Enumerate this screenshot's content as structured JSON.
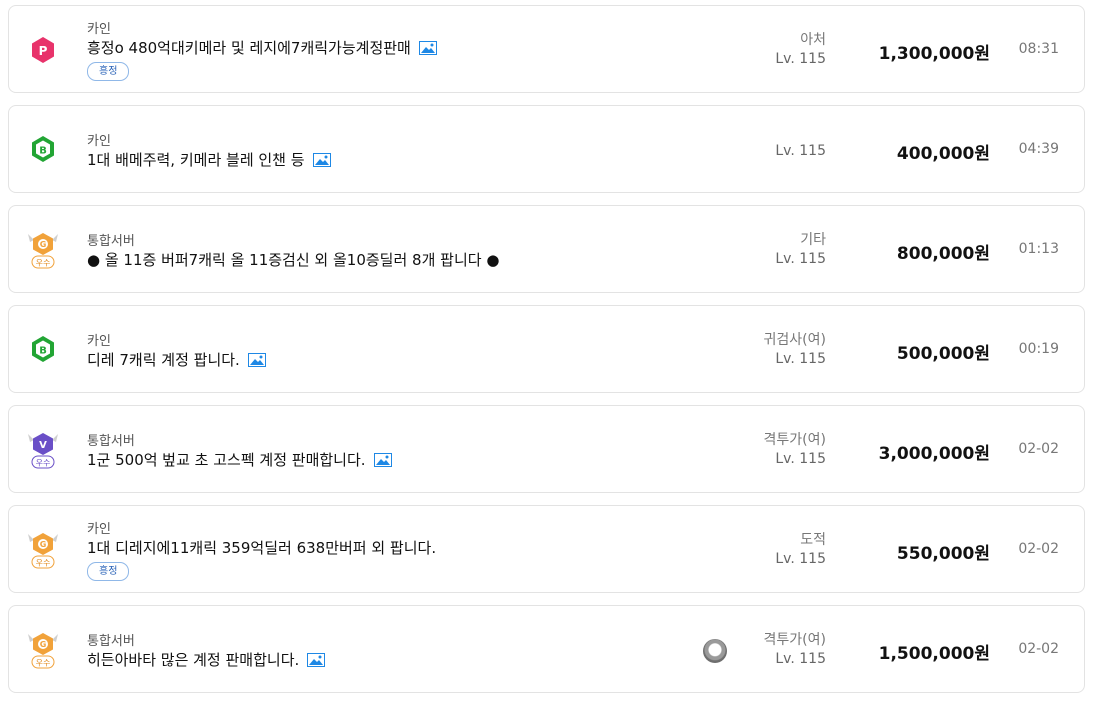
{
  "colors": {
    "p_badge": "#e8336b",
    "b_badge": "#22a534",
    "v_badge": "#6a4fc7",
    "gold_badge": "#f1a23a",
    "tag_border": "#90b8e8",
    "tag_text": "#2b64b8",
    "image_icon": "#1e88e5"
  },
  "listings": [
    {
      "badge": "p-badge-icon",
      "server": "카인",
      "title": "흥정o 480억대키메라 및 레지에7캐릭가능계정판매",
      "has_image": true,
      "tag": "흥정",
      "job": "아처",
      "level": "Lv. 115",
      "price": "1,300,000원",
      "time": "08:31"
    },
    {
      "badge": "b-badge-icon",
      "server": "카인",
      "title": "1대 배메주력, 키메라 블레 인챈 등",
      "has_image": true,
      "tag": "",
      "job": "",
      "level": "Lv. 115",
      "price": "400,000원",
      "time": "04:39"
    },
    {
      "badge": "gold-excellent-badge-icon",
      "badge_text": "우수",
      "server": "통합서버",
      "title": "● 올 11증 버퍼7캐릭 올 11증검신 외 올10증딜러 8개 팝니다 ●",
      "has_image": false,
      "tag": "",
      "job": "기타",
      "level": "Lv. 115",
      "price": "800,000원",
      "time": "01:13"
    },
    {
      "badge": "b-badge-icon",
      "server": "카인",
      "title": "디레 7캐릭 계정 팝니다.",
      "has_image": true,
      "tag": "",
      "job": "귀검사(여)",
      "level": "Lv. 115",
      "price": "500,000원",
      "time": "00:19"
    },
    {
      "badge": "v-excellent-badge-icon",
      "badge_text": "우수",
      "server": "통합서버",
      "title": "1군 500억 벞교 초 고스펙 계정 판매합니다.",
      "has_image": true,
      "tag": "",
      "job": "격투가(여)",
      "level": "Lv. 115",
      "price": "3,000,000원",
      "time": "02-02"
    },
    {
      "badge": "gold-excellent-badge-icon",
      "badge_text": "우수",
      "server": "카인",
      "title": "1대 디레지에11캐릭 359억딜러 638만버퍼 외 팝니다.",
      "has_image": false,
      "tag": "흥정",
      "job": "도적",
      "level": "Lv. 115",
      "price": "550,000원",
      "time": "02-02"
    },
    {
      "badge": "gold-excellent-badge-icon",
      "badge_text": "우수",
      "server": "통합서버",
      "title": "히든아바타 많은 계정 판매합니다.",
      "has_image": true,
      "tag": "",
      "job": "격투가(여)",
      "level": "Lv. 115",
      "price": "1,500,000원",
      "time": "02-02",
      "seller_avatar": "seller-avatar-icon"
    }
  ]
}
